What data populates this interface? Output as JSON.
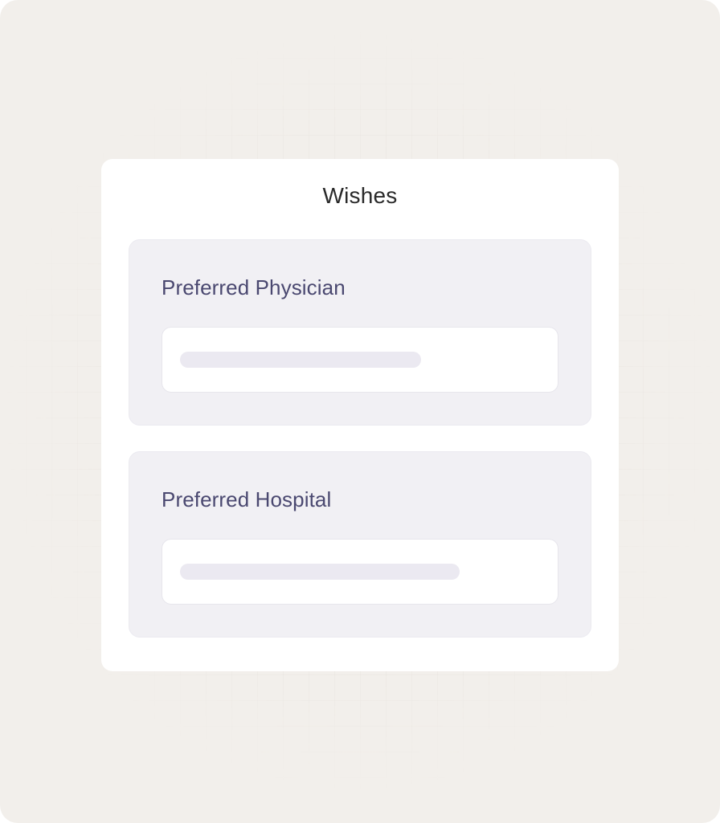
{
  "card": {
    "title": "Wishes"
  },
  "sections": [
    {
      "label": "Preferred Physician",
      "input": {
        "value": ""
      }
    },
    {
      "label": "Preferred Hospital",
      "input": {
        "value": ""
      }
    }
  ],
  "colors": {
    "background": "#f2efeb",
    "card": "#ffffff",
    "section": "#f1f0f4",
    "label_text": "#4a4870",
    "title_text": "#2a2a2a",
    "placeholder_bar": "#ebe9f1"
  }
}
